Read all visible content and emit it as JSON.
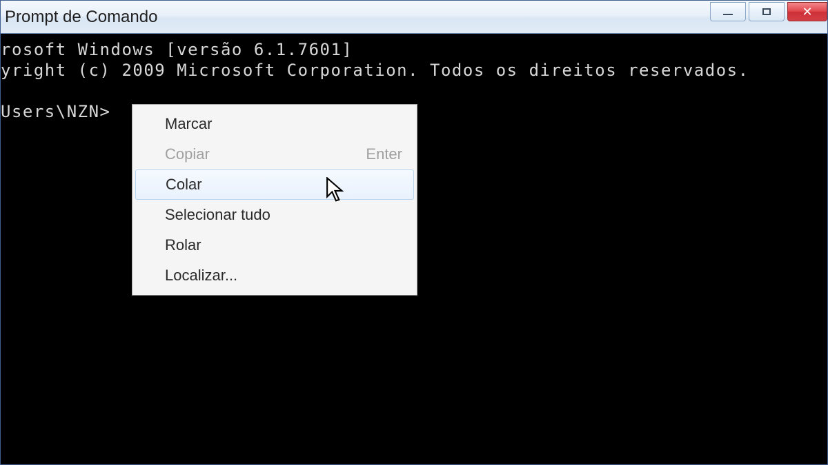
{
  "window": {
    "title": "Prompt de Comando"
  },
  "terminal": {
    "line1": "rosoft Windows [versão 6.1.7601]",
    "line2": "yright (c) 2009 Microsoft Corporation. Todos os direitos reservados.",
    "line3": " ",
    "prompt": "Users\\NZN>"
  },
  "context_menu": {
    "items": [
      {
        "label": "Marcar",
        "disabled": false,
        "hover": false,
        "shortcut": ""
      },
      {
        "label": "Copiar",
        "disabled": true,
        "hover": false,
        "shortcut": "Enter"
      },
      {
        "label": "Colar",
        "disabled": false,
        "hover": true,
        "shortcut": ""
      },
      {
        "label": "Selecionar tudo",
        "disabled": false,
        "hover": false,
        "shortcut": ""
      },
      {
        "label": "Rolar",
        "disabled": false,
        "hover": false,
        "shortcut": ""
      },
      {
        "label": "Localizar...",
        "disabled": false,
        "hover": false,
        "shortcut": ""
      }
    ]
  }
}
